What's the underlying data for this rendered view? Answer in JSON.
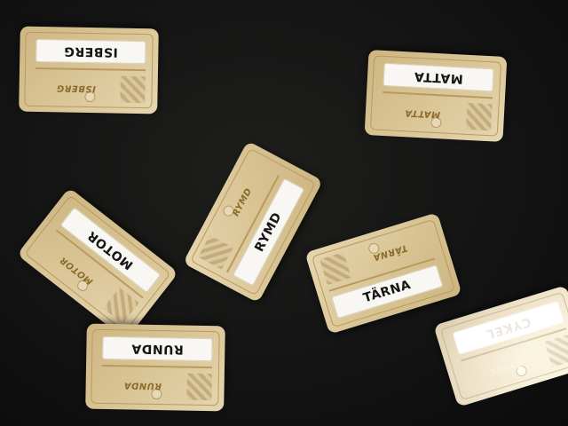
{
  "scene": {
    "description_labels": "photo of word cards on a dark table",
    "cards": [
      {
        "main": "ISBERG",
        "small": "ISBERG"
      },
      {
        "main": "MATTA",
        "small": "MATTA"
      },
      {
        "main": "RYMD",
        "small": "RYMD"
      },
      {
        "main": "MOTOR",
        "small": "MOTOR"
      },
      {
        "main": "TÄRNA",
        "small": "TÄRNA"
      },
      {
        "main": "RUNDA",
        "small": "RUNDA"
      },
      {
        "main": "CYKEL",
        "small": "CYKEL"
      }
    ]
  }
}
